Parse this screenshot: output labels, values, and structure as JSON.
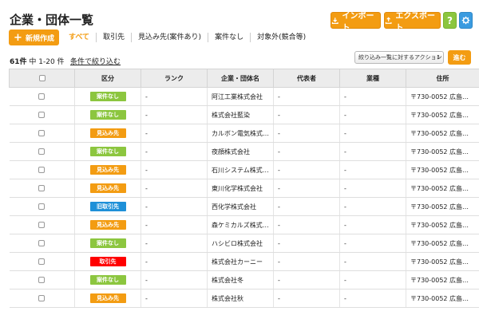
{
  "page": {
    "title": "企業・団体一覧"
  },
  "toolbar": {
    "import_label": "インポート",
    "export_label": "エクスポート",
    "help_label": "?",
    "new_label": "新規作成"
  },
  "filters": [
    "すべて",
    "取引先",
    "見込み先(案件あり)",
    "案件なし",
    "対象外(競合等)"
  ],
  "result": {
    "total": "61件",
    "range": "中 1-20 件",
    "condition_link": "条件で絞り込む"
  },
  "action": {
    "select_value": "絞り込み一覧に対するアクション",
    "go_label": "進む"
  },
  "colors": {
    "case_none": "#8cc63f",
    "prospect": "#f39c12",
    "trading": "#ff0000",
    "ex_trading": "#1e90d8",
    "accent": "#f39c12"
  },
  "table": {
    "columns": [
      "",
      "区分",
      "ランク",
      "企業・団体名",
      "代表者",
      "業種",
      "住所"
    ],
    "rows": [
      {
        "category": "案件なし",
        "kind": "case_none",
        "rank": "-",
        "name": "阿江工業株式会社",
        "rep": "-",
        "industry": "-",
        "address": "〒730-0052 広島…"
      },
      {
        "category": "案件なし",
        "kind": "case_none",
        "rank": "-",
        "name": "株式会社藍染",
        "rep": "-",
        "industry": "-",
        "address": "〒730-0052 広島…"
      },
      {
        "category": "見込み先",
        "kind": "prospect",
        "rank": "-",
        "name": "カルボン電気株式…",
        "rep": "-",
        "industry": "-",
        "address": "〒730-0052 広島…"
      },
      {
        "category": "案件なし",
        "kind": "case_none",
        "rank": "-",
        "name": "夜顔株式会社",
        "rep": "-",
        "industry": "-",
        "address": "〒730-0052 広島…"
      },
      {
        "category": "見込み先",
        "kind": "prospect",
        "rank": "-",
        "name": "石川システム株式…",
        "rep": "-",
        "industry": "-",
        "address": "〒730-0052 広島…"
      },
      {
        "category": "見込み先",
        "kind": "prospect",
        "rank": "-",
        "name": "東川化学株式会社",
        "rep": "-",
        "industry": "-",
        "address": "〒730-0052 広島…"
      },
      {
        "category": "旧取引先",
        "kind": "ex_trading",
        "rank": "-",
        "name": "西化学株式会社",
        "rep": "-",
        "industry": "-",
        "address": "〒730-0052 広島…"
      },
      {
        "category": "見込み先",
        "kind": "prospect",
        "rank": "-",
        "name": "森ケミカルズ株式…",
        "rep": "-",
        "industry": "-",
        "address": "〒730-0052 広島…"
      },
      {
        "category": "案件なし",
        "kind": "case_none",
        "rank": "-",
        "name": "ハシビロ株式会社",
        "rep": "-",
        "industry": "-",
        "address": "〒730-0052 広島…"
      },
      {
        "category": "取引先",
        "kind": "trading",
        "rank": "-",
        "name": "株式会社カーニー",
        "rep": "-",
        "industry": "-",
        "address": "〒730-0052 広島…"
      },
      {
        "category": "案件なし",
        "kind": "case_none",
        "rank": "-",
        "name": "株式会社冬",
        "rep": "-",
        "industry": "-",
        "address": "〒730-0052 広島…"
      },
      {
        "category": "見込み先",
        "kind": "prospect",
        "rank": "-",
        "name": "株式会社秋",
        "rep": "-",
        "industry": "-",
        "address": "〒730-0052 広島…"
      }
    ]
  }
}
